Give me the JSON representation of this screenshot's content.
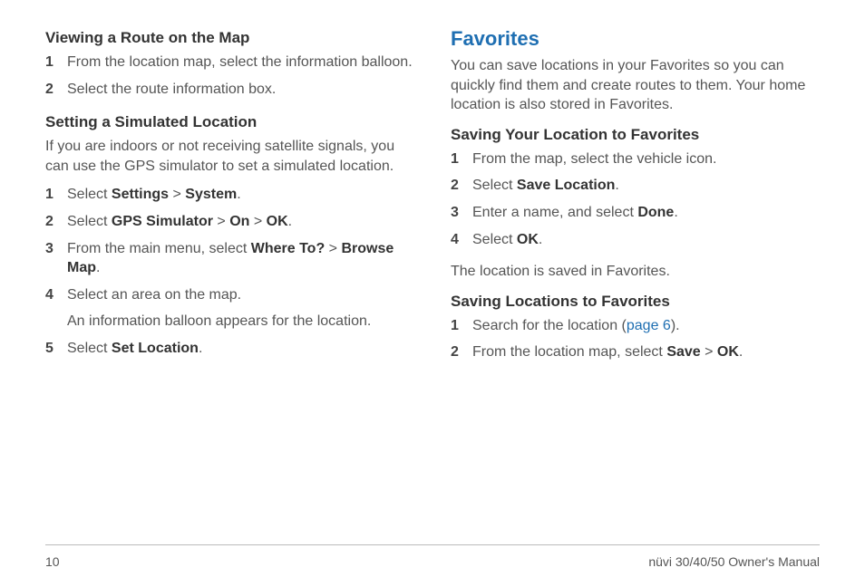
{
  "left": {
    "section1": {
      "heading": "Viewing a Route on the Map",
      "items": [
        {
          "num": "1",
          "runs": [
            {
              "t": "From the location map, select the information balloon."
            }
          ]
        },
        {
          "num": "2",
          "runs": [
            {
              "t": "Select the route information box."
            }
          ]
        }
      ]
    },
    "section2": {
      "heading": "Setting a Simulated Location",
      "intro": "If you are indoors or not receiving satellite signals, you can use the GPS simulator to set a simulated location.",
      "items": [
        {
          "num": "1",
          "runs": [
            {
              "t": "Select "
            },
            {
              "t": "Settings",
              "b": true
            },
            {
              "t": " > "
            },
            {
              "t": "System",
              "b": true
            },
            {
              "t": "."
            }
          ]
        },
        {
          "num": "2",
          "runs": [
            {
              "t": "Select "
            },
            {
              "t": "GPS Simulator",
              "b": true
            },
            {
              "t": " > "
            },
            {
              "t": "On",
              "b": true
            },
            {
              "t": " > "
            },
            {
              "t": "OK",
              "b": true
            },
            {
              "t": "."
            }
          ]
        },
        {
          "num": "3",
          "runs": [
            {
              "t": "From the main menu, select "
            },
            {
              "t": "Where To?",
              "b": true
            },
            {
              "t": " > "
            },
            {
              "t": "Browse Map",
              "b": true
            },
            {
              "t": "."
            }
          ]
        },
        {
          "num": "4",
          "runs": [
            {
              "t": "Select an area on the map."
            }
          ],
          "sub": "An information balloon appears for the location."
        },
        {
          "num": "5",
          "runs": [
            {
              "t": "Select "
            },
            {
              "t": "Set Location",
              "b": true
            },
            {
              "t": "."
            }
          ]
        }
      ]
    }
  },
  "right": {
    "title": "Favorites",
    "intro": "You can save locations in your Favorites so you can quickly find them and create routes to them. Your home location is also stored in Favorites.",
    "section1": {
      "heading": "Saving Your Location to Favorites",
      "items": [
        {
          "num": "1",
          "runs": [
            {
              "t": "From the map, select the vehicle icon."
            }
          ]
        },
        {
          "num": "2",
          "runs": [
            {
              "t": "Select "
            },
            {
              "t": "Save Location",
              "b": true
            },
            {
              "t": "."
            }
          ]
        },
        {
          "num": "3",
          "runs": [
            {
              "t": "Enter a name, and select "
            },
            {
              "t": "Done",
              "b": true
            },
            {
              "t": "."
            }
          ]
        },
        {
          "num": "4",
          "runs": [
            {
              "t": "Select "
            },
            {
              "t": "OK",
              "b": true
            },
            {
              "t": "."
            }
          ]
        }
      ],
      "outro": "The location is saved in Favorites."
    },
    "section2": {
      "heading": "Saving Locations to Favorites",
      "items": [
        {
          "num": "1",
          "runs": [
            {
              "t": "Search for the location ("
            },
            {
              "t": "page 6",
              "link": true
            },
            {
              "t": ")."
            }
          ]
        },
        {
          "num": "2",
          "runs": [
            {
              "t": "From the location map, select "
            },
            {
              "t": "Save",
              "b": true
            },
            {
              "t": " > "
            },
            {
              "t": "OK",
              "b": true
            },
            {
              "t": "."
            }
          ]
        }
      ]
    }
  },
  "footer": {
    "page": "10",
    "doc": "nüvi 30/40/50 Owner's Manual"
  }
}
